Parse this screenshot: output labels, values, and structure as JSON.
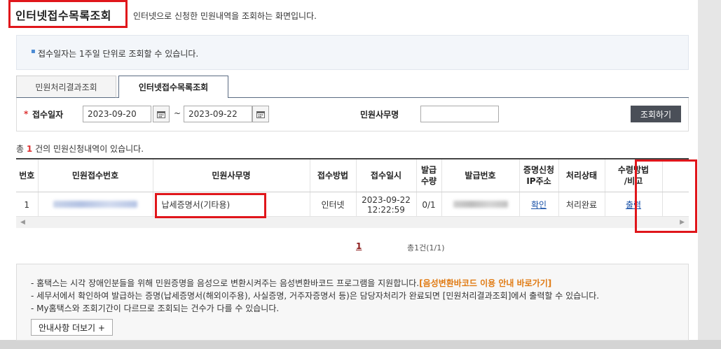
{
  "header": {
    "title": "인터넷접수목록조회",
    "subtitle": "인터넷으로 신청한 민원내역을 조회하는 화면입니다."
  },
  "notice": {
    "text": "접수일자는 1주일 단위로 조회할 수 있습니다."
  },
  "tabs": [
    {
      "label": "민원처리결과조회",
      "active": false
    },
    {
      "label": "인터넷접수목록조회",
      "active": true
    }
  ],
  "search": {
    "date_label": "접수일자",
    "required_mark": "*",
    "start_date": "2023-09-20",
    "end_date": "2023-09-22",
    "range_separator": "~",
    "name_label": "민원사무명",
    "name_value": "",
    "submit_label": "조회하기"
  },
  "results": {
    "count_prefix": "총",
    "count": "1",
    "count_suffix": "건의 민원신청내역이 있습니다."
  },
  "table": {
    "columns": [
      "번호",
      "민원접수번호",
      "민원사무명",
      "접수방법",
      "접수일시",
      "발급\n수량",
      "발급번호",
      "증명신청\nIP주소",
      "처리상태",
      "수령방법\n/비고"
    ],
    "rows": [
      {
        "no": "1",
        "name": "납세증명서(기타용)",
        "method": "인터넷",
        "date": "2023-09-22",
        "time": "12:22:59",
        "qty": "0/1",
        "ip_link": "확인",
        "status": "처리완료",
        "receive_link": "출력"
      }
    ]
  },
  "pagination": {
    "current": "1",
    "total_text": "총1건(1/1)"
  },
  "info": {
    "line1_prefix": "- 홈택스는 시각 장애인분들을 위해 민원증명을 음성으로 변환시켜주는 음성변환바코드 프로그램을 지원합니다.",
    "line1_link": "[음성변환바코드 이용 안내 바로가기]",
    "line2": "- 세무서에서 확인하여 발급하는 증명(납세증명서(해외이주용), 사실증명, 거주자증명서 등)은 담당자처리가 완료되면 [민원처리결과조회]에서 출력할 수 있습니다.",
    "line3": "- My홈택스와 조회기간이 다르므로 조회되는 건수가 다를 수 있습니다.",
    "more_label": "안내사항 더보기 +"
  },
  "icons": {
    "calendar": "calendar-icon",
    "scroll_left": "arrow-left-icon",
    "scroll_right": "arrow-right-icon"
  },
  "colors": {
    "highlight_box": "#e0161b",
    "link": "#1a52a8",
    "required": "#dd3333",
    "notice_bg": "#f3f6fa",
    "button_dark": "#4a4f58",
    "info_highlight": "#e07a12"
  }
}
